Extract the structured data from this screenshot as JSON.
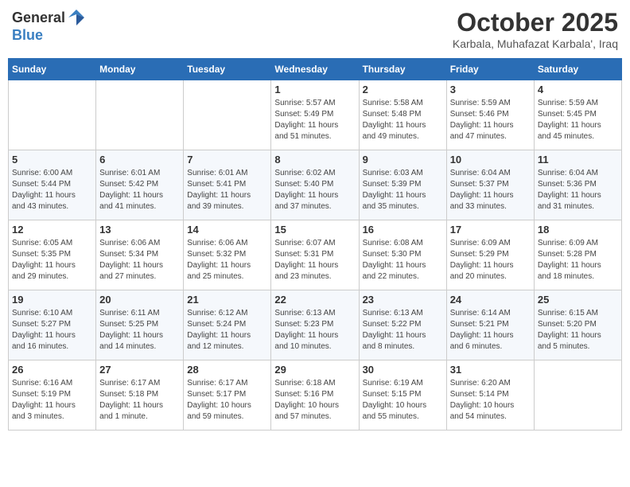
{
  "logo": {
    "general": "General",
    "blue": "Blue"
  },
  "title": {
    "month_year": "October 2025",
    "location": "Karbala, Muhafazat Karbala', Iraq"
  },
  "calendar": {
    "headers": [
      "Sunday",
      "Monday",
      "Tuesday",
      "Wednesday",
      "Thursday",
      "Friday",
      "Saturday"
    ],
    "weeks": [
      [
        {
          "day": "",
          "info": ""
        },
        {
          "day": "",
          "info": ""
        },
        {
          "day": "",
          "info": ""
        },
        {
          "day": "1",
          "info": "Sunrise: 5:57 AM\nSunset: 5:49 PM\nDaylight: 11 hours\nand 51 minutes."
        },
        {
          "day": "2",
          "info": "Sunrise: 5:58 AM\nSunset: 5:48 PM\nDaylight: 11 hours\nand 49 minutes."
        },
        {
          "day": "3",
          "info": "Sunrise: 5:59 AM\nSunset: 5:46 PM\nDaylight: 11 hours\nand 47 minutes."
        },
        {
          "day": "4",
          "info": "Sunrise: 5:59 AM\nSunset: 5:45 PM\nDaylight: 11 hours\nand 45 minutes."
        }
      ],
      [
        {
          "day": "5",
          "info": "Sunrise: 6:00 AM\nSunset: 5:44 PM\nDaylight: 11 hours\nand 43 minutes."
        },
        {
          "day": "6",
          "info": "Sunrise: 6:01 AM\nSunset: 5:42 PM\nDaylight: 11 hours\nand 41 minutes."
        },
        {
          "day": "7",
          "info": "Sunrise: 6:01 AM\nSunset: 5:41 PM\nDaylight: 11 hours\nand 39 minutes."
        },
        {
          "day": "8",
          "info": "Sunrise: 6:02 AM\nSunset: 5:40 PM\nDaylight: 11 hours\nand 37 minutes."
        },
        {
          "day": "9",
          "info": "Sunrise: 6:03 AM\nSunset: 5:39 PM\nDaylight: 11 hours\nand 35 minutes."
        },
        {
          "day": "10",
          "info": "Sunrise: 6:04 AM\nSunset: 5:37 PM\nDaylight: 11 hours\nand 33 minutes."
        },
        {
          "day": "11",
          "info": "Sunrise: 6:04 AM\nSunset: 5:36 PM\nDaylight: 11 hours\nand 31 minutes."
        }
      ],
      [
        {
          "day": "12",
          "info": "Sunrise: 6:05 AM\nSunset: 5:35 PM\nDaylight: 11 hours\nand 29 minutes."
        },
        {
          "day": "13",
          "info": "Sunrise: 6:06 AM\nSunset: 5:34 PM\nDaylight: 11 hours\nand 27 minutes."
        },
        {
          "day": "14",
          "info": "Sunrise: 6:06 AM\nSunset: 5:32 PM\nDaylight: 11 hours\nand 25 minutes."
        },
        {
          "day": "15",
          "info": "Sunrise: 6:07 AM\nSunset: 5:31 PM\nDaylight: 11 hours\nand 23 minutes."
        },
        {
          "day": "16",
          "info": "Sunrise: 6:08 AM\nSunset: 5:30 PM\nDaylight: 11 hours\nand 22 minutes."
        },
        {
          "day": "17",
          "info": "Sunrise: 6:09 AM\nSunset: 5:29 PM\nDaylight: 11 hours\nand 20 minutes."
        },
        {
          "day": "18",
          "info": "Sunrise: 6:09 AM\nSunset: 5:28 PM\nDaylight: 11 hours\nand 18 minutes."
        }
      ],
      [
        {
          "day": "19",
          "info": "Sunrise: 6:10 AM\nSunset: 5:27 PM\nDaylight: 11 hours\nand 16 minutes."
        },
        {
          "day": "20",
          "info": "Sunrise: 6:11 AM\nSunset: 5:25 PM\nDaylight: 11 hours\nand 14 minutes."
        },
        {
          "day": "21",
          "info": "Sunrise: 6:12 AM\nSunset: 5:24 PM\nDaylight: 11 hours\nand 12 minutes."
        },
        {
          "day": "22",
          "info": "Sunrise: 6:13 AM\nSunset: 5:23 PM\nDaylight: 11 hours\nand 10 minutes."
        },
        {
          "day": "23",
          "info": "Sunrise: 6:13 AM\nSunset: 5:22 PM\nDaylight: 11 hours\nand 8 minutes."
        },
        {
          "day": "24",
          "info": "Sunrise: 6:14 AM\nSunset: 5:21 PM\nDaylight: 11 hours\nand 6 minutes."
        },
        {
          "day": "25",
          "info": "Sunrise: 6:15 AM\nSunset: 5:20 PM\nDaylight: 11 hours\nand 5 minutes."
        }
      ],
      [
        {
          "day": "26",
          "info": "Sunrise: 6:16 AM\nSunset: 5:19 PM\nDaylight: 11 hours\nand 3 minutes."
        },
        {
          "day": "27",
          "info": "Sunrise: 6:17 AM\nSunset: 5:18 PM\nDaylight: 11 hours\nand 1 minute."
        },
        {
          "day": "28",
          "info": "Sunrise: 6:17 AM\nSunset: 5:17 PM\nDaylight: 10 hours\nand 59 minutes."
        },
        {
          "day": "29",
          "info": "Sunrise: 6:18 AM\nSunset: 5:16 PM\nDaylight: 10 hours\nand 57 minutes."
        },
        {
          "day": "30",
          "info": "Sunrise: 6:19 AM\nSunset: 5:15 PM\nDaylight: 10 hours\nand 55 minutes."
        },
        {
          "day": "31",
          "info": "Sunrise: 6:20 AM\nSunset: 5:14 PM\nDaylight: 10 hours\nand 54 minutes."
        },
        {
          "day": "",
          "info": ""
        }
      ]
    ]
  }
}
